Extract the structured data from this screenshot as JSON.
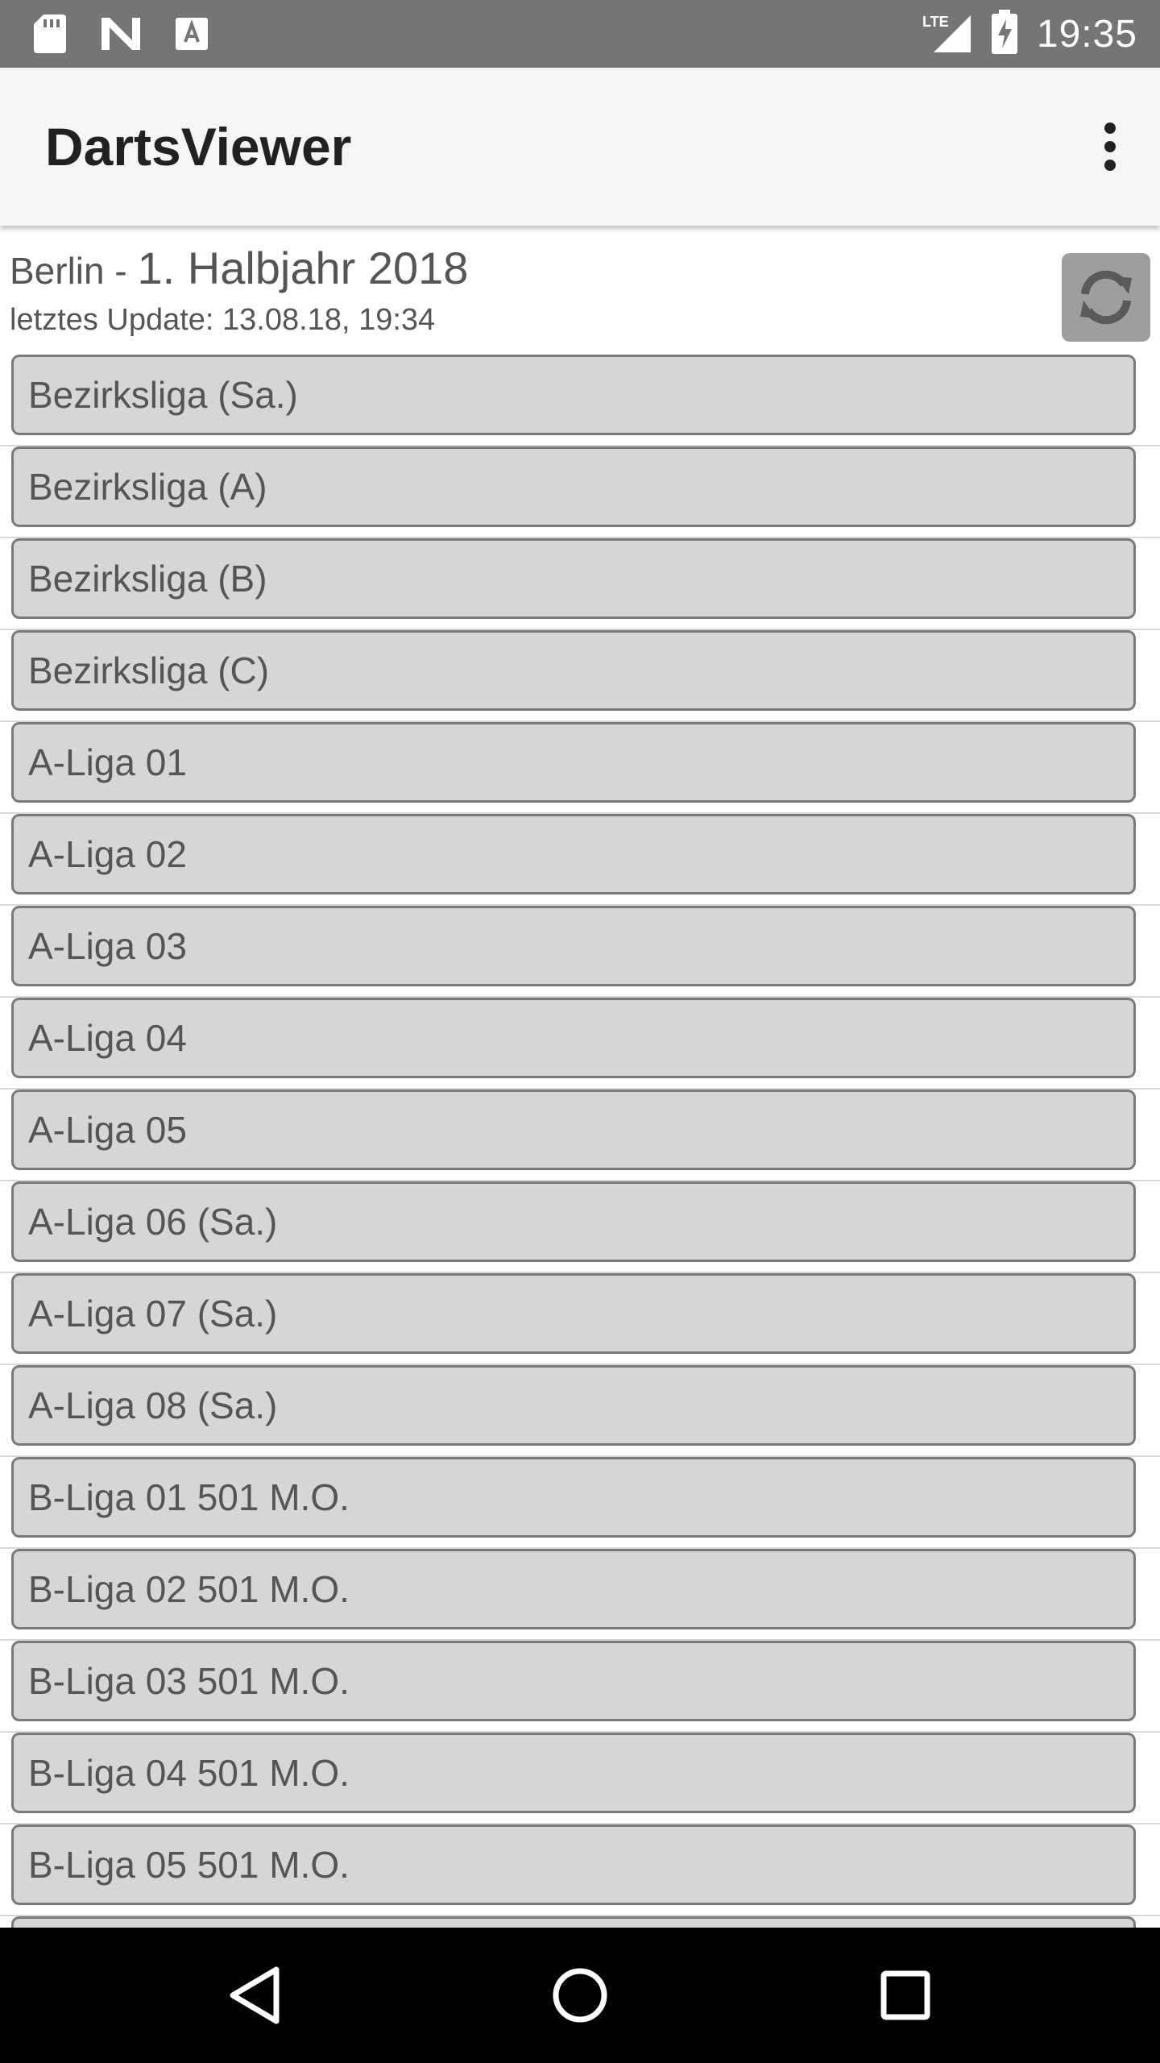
{
  "status_bar": {
    "time": "19:35",
    "network": "LTE",
    "icons": [
      "sd-card-icon",
      "n-icon",
      "font-icon",
      "lte-signal-icon",
      "battery-charging-icon"
    ]
  },
  "app_bar": {
    "title": "DartsViewer",
    "menu_icon": "more-vert-icon"
  },
  "header": {
    "city": "Berlin",
    "separator": " - ",
    "season": "1. Halbjahr 2018",
    "last_update": "letztes Update: 13.08.18, 19:34",
    "refresh_icon": "refresh-icon"
  },
  "leagues": [
    "Bezirksliga (Sa.)",
    "Bezirksliga (A)",
    "Bezirksliga (B)",
    "Bezirksliga (C)",
    "A-Liga 01",
    "A-Liga 02",
    "A-Liga 03",
    "A-Liga 04",
    "A-Liga 05",
    "A-Liga 06 (Sa.)",
    "A-Liga 07 (Sa.)",
    "A-Liga 08 (Sa.)",
    "B-Liga 01 501 M.O.",
    "B-Liga 02 501 M.O.",
    "B-Liga 03 501 M.O.",
    "B-Liga 04 501 M.O.",
    "B-Liga 05 501 M.O.",
    ""
  ],
  "nav_bar": {
    "icons": [
      "back-icon",
      "home-icon",
      "recents-icon"
    ]
  },
  "colors": {
    "status_bar": "#757575",
    "app_bar": "#f5f5f5",
    "button_bg": "#d6d6d6",
    "button_border": "#7a7a7a",
    "refresh_bg": "#9e9e9e",
    "nav_bar": "#000000"
  }
}
